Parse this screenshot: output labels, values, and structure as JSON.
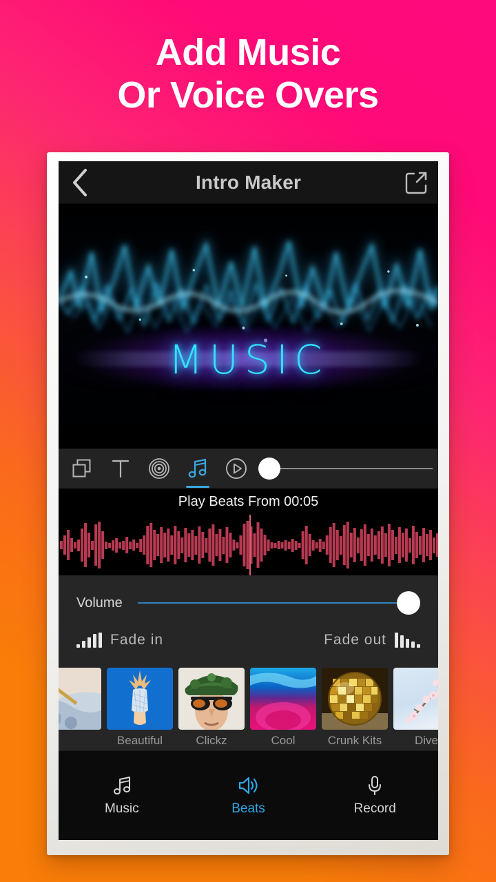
{
  "promo": {
    "line1": "Add Music",
    "line2": "Or Voice Overs",
    "bg_from": "#F97D08",
    "bg_to": "#FF0A7D"
  },
  "navbar": {
    "back_icon": "chevron-left-icon",
    "title": "Intro Maker",
    "export_icon": "share-export-icon"
  },
  "preview": {
    "overlay_text": "MUSIC",
    "neon_color": "#35E0FF",
    "glow_color": "#9628FF"
  },
  "toolbar": {
    "items": [
      {
        "icon": "layers-icon",
        "active": false
      },
      {
        "icon": "text-icon",
        "active": false
      },
      {
        "icon": "target-rings-icon",
        "active": false
      },
      {
        "icon": "music-note-icon",
        "active": true
      },
      {
        "icon": "play-circle-icon",
        "active": false
      }
    ],
    "active_color": "#3AA8E0",
    "scrubber_position": "0%"
  },
  "beats": {
    "heading": "Play Beats From 00:05",
    "waveform_color": "#B83A52",
    "playhead_color": "#E06070",
    "playhead_position": "50%"
  },
  "controls": {
    "volume_label": "Volume",
    "volume_value": "100%",
    "volume_track_color": "#2F82C4",
    "fade_in_label": "Fade in",
    "fade_in_icon": "bars-ascending-icon",
    "fade_out_label": "Fade out",
    "fade_out_icon": "bars-descending-icon"
  },
  "thumbnails": [
    {
      "label": "",
      "name": "thumb-partial"
    },
    {
      "label": "Beautiful",
      "name": "thumb-beautiful"
    },
    {
      "label": "Clickz",
      "name": "thumb-clickz"
    },
    {
      "label": "Cool",
      "name": "thumb-cool"
    },
    {
      "label": "Crunk Kits",
      "name": "thumb-crunk-kits"
    },
    {
      "label": "Dive",
      "name": "thumb-dive"
    }
  ],
  "tabs": [
    {
      "label": "Music",
      "icon": "music-note-icon",
      "active": false
    },
    {
      "label": "Beats",
      "icon": "speaker-waves-icon",
      "active": true
    },
    {
      "label": "Record",
      "icon": "microphone-icon",
      "active": false
    }
  ],
  "tab_active_color": "#2EA9E8"
}
